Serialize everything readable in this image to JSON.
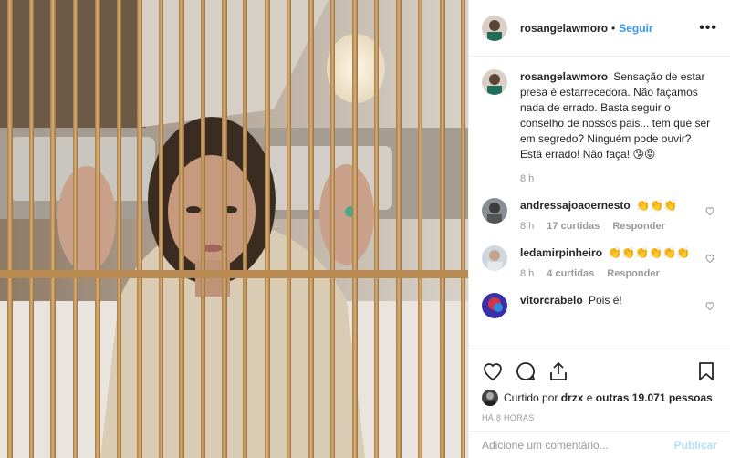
{
  "header": {
    "username": "rosangelawmoro",
    "separator": "•",
    "follow_label": "Seguir",
    "more_label": "•••"
  },
  "caption": {
    "username": "rosangelawmoro",
    "text": "Sensação de estar presa é estarrecedora. Não façamos nada de errado. Basta seguir o conselho de nossos pais... tem que ser em segredo? Ninguém pode ouvir? Está errado! Não faça! 😘😝",
    "time": "8 h"
  },
  "comments": [
    {
      "username": "andressajoaoernesto",
      "text": "👏👏👏",
      "time": "8 h",
      "likes": "17 curtidas",
      "reply": "Responder"
    },
    {
      "username": "ledamirpinheiro",
      "text": "👏👏👏👏👏👏",
      "time": "8 h",
      "likes": "4 curtidas",
      "reply": "Responder"
    },
    {
      "username": "vitorcrabelo",
      "text": "Pois é!"
    }
  ],
  "likes": {
    "prefix": "Curtido por",
    "first_user": "drzx",
    "conjunction": "e",
    "others": "outras 19.071 pessoas"
  },
  "timestamp": "HÁ 8 HORAS",
  "add_comment": {
    "placeholder": "Adicione um comentário...",
    "publish_label": "Publicar"
  },
  "colors": {
    "link": "#3897f0",
    "publish_disabled": "#b2dffc",
    "muted": "#999999"
  },
  "icons": [
    "more-icon",
    "heart-icon",
    "comment-icon",
    "share-icon",
    "bookmark-icon"
  ]
}
